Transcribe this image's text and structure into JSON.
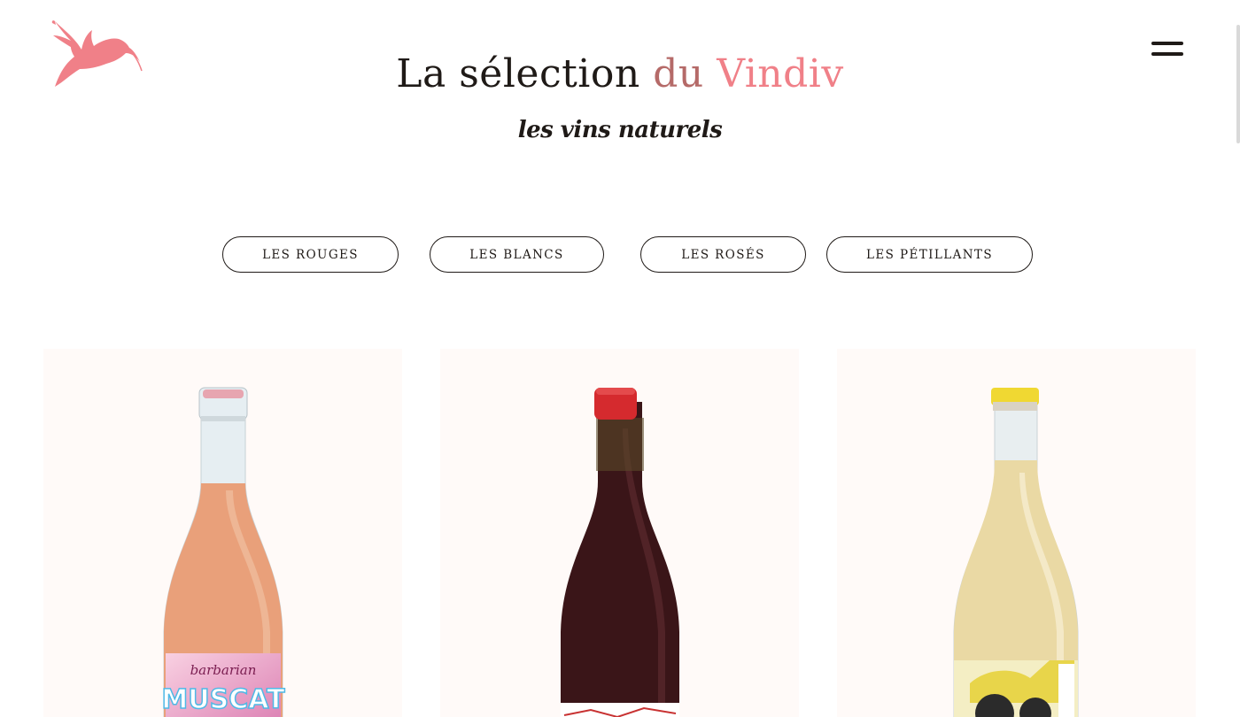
{
  "header": {
    "title_main": "La sélection",
    "title_accent_1": "du",
    "title_accent_2": "Vindiv",
    "subtitle": "les vins naturels"
  },
  "filters": [
    {
      "label": "LES ROUGES"
    },
    {
      "label": "LES BLANCS"
    },
    {
      "label": "LES ROSÉS"
    },
    {
      "label": "LES PÉTILLANTS"
    }
  ],
  "products": [
    {
      "label_text_1": "barbarian",
      "label_text_2": "MUSCAT",
      "wine_color": "#e9a07a",
      "cap_color": "#e7a5b0"
    },
    {
      "label_text_1": "",
      "label_text_2": "",
      "wine_color": "#3a1518",
      "cap_color": "#d52a2e"
    },
    {
      "label_text_1": "",
      "label_text_2": "",
      "wine_color": "#ead9a4",
      "cap_color": "#f0d832"
    }
  ],
  "colors": {
    "accent": "#f08088",
    "text": "#1f1a17",
    "card_bg": "#fffaf8"
  },
  "icons": {
    "logo": "hummingbird-icon",
    "menu": "hamburger-menu-icon"
  }
}
